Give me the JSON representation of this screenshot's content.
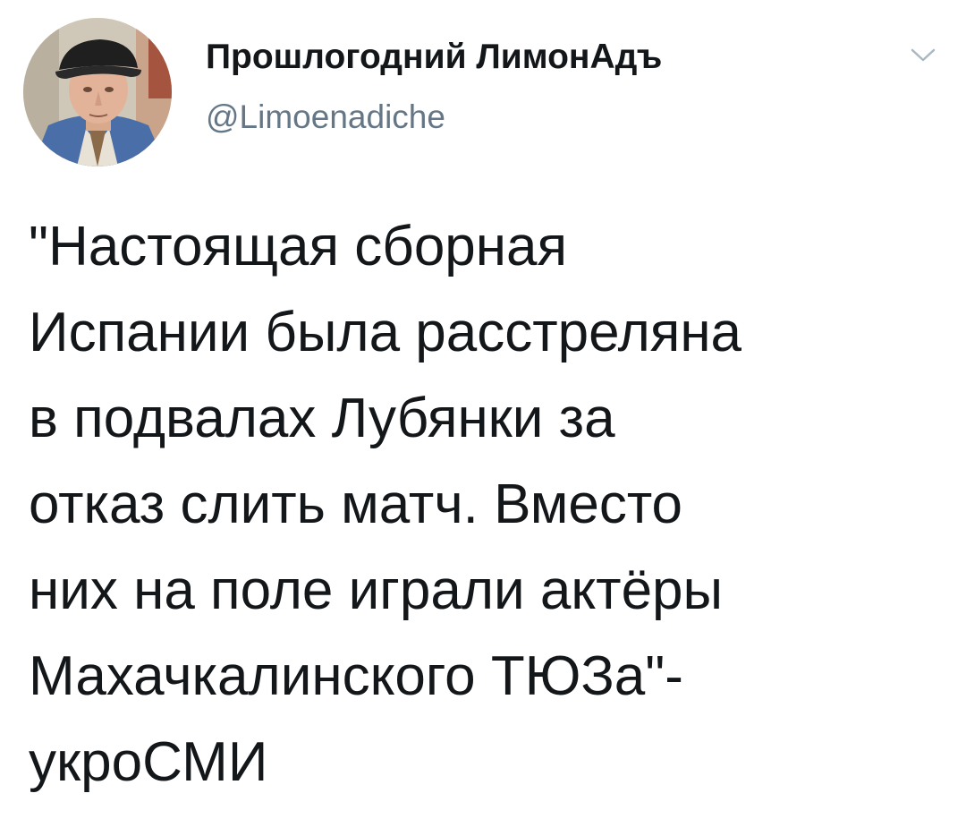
{
  "tweet": {
    "author": {
      "display_name": "Прошлогодний ЛимонАдъ",
      "handle": "@Limoenadiche",
      "avatar_icon": "profile-photo"
    },
    "menu_icon": "chevron-down-icon",
    "text_lines": [
      "\"Настоящая сборная",
      "Испании была расстреляна",
      "в подвалах Лубянки за",
      "отказ слить матч. Вместо",
      "них на поле играли актёры",
      "Махачкалинского ТЮЗа\"-",
      "укроСМИ"
    ]
  },
  "colors": {
    "text": "#14171a",
    "secondary": "#657786",
    "background": "#ffffff",
    "caret": "#aab8c2"
  }
}
